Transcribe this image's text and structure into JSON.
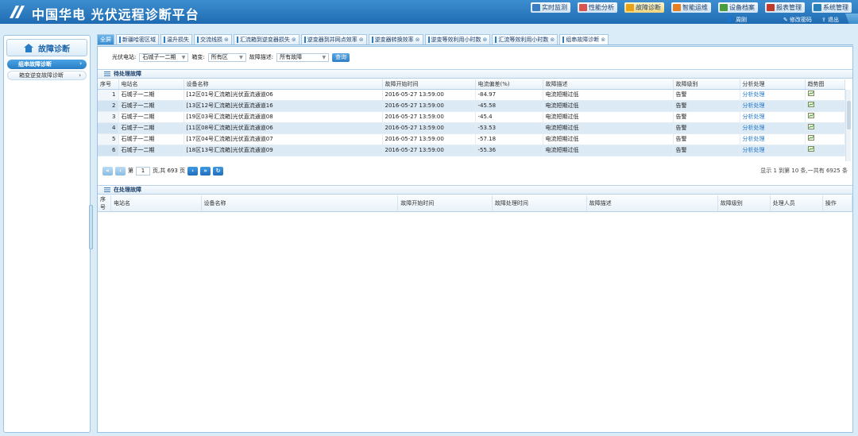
{
  "app": {
    "title": "中国华电 光伏远程诊断平台"
  },
  "topnav": [
    {
      "label": "实时监测",
      "color": "#3b7ec0"
    },
    {
      "label": "性能分析",
      "color": "#d9534f"
    },
    {
      "label": "故障诊断",
      "color": "#e8a21a"
    },
    {
      "label": "智能运维",
      "color": "#e67e22"
    },
    {
      "label": "设备档案",
      "color": "#4a9d3e"
    },
    {
      "label": "报表管理",
      "color": "#c0392b"
    },
    {
      "label": "系统管理",
      "color": "#2980b9"
    }
  ],
  "userbar": {
    "username": "周刚",
    "change_password": "修改密码",
    "logout": "退出"
  },
  "sidebar": {
    "title": "故障诊断",
    "items": [
      {
        "label": "组串故障诊断",
        "active": true
      },
      {
        "label": "箱变逆变故障诊断",
        "active": false
      }
    ]
  },
  "tabs": [
    {
      "label": "全屏"
    },
    {
      "label": "新疆哈密区域"
    },
    {
      "label": "温升损失"
    },
    {
      "label": "交流线损"
    },
    {
      "label": "汇流箱到逆变器损失"
    },
    {
      "label": "逆变器到并网点效率"
    },
    {
      "label": "逆变器转换效率"
    },
    {
      "label": "逆变等效利用小时数"
    },
    {
      "label": "汇流等效利用小时数"
    },
    {
      "label": "组串故障诊断"
    }
  ],
  "filters": {
    "station_label": "光伏电站:",
    "station_value": "石城子一二期",
    "area_label": "箱变:",
    "area_value": "所有区",
    "desc_label": "故障描述:",
    "desc_value": "所有故障",
    "query_button": "查询"
  },
  "pending": {
    "title": "待处理故障",
    "columns": [
      "序号",
      "电站名",
      "设备名称",
      "故障开始时间",
      "电流偏差(%)",
      "故障描述",
      "故障级别",
      "分析处理",
      "趋势图"
    ],
    "rows": [
      {
        "no": "1",
        "station": "石城子一二期",
        "device": "[12区01号汇流箱]光伏直流通道06",
        "time": "2016-05-27 13:59:00",
        "dev": "-84.97",
        "desc": "电流短期过低",
        "level": "告警",
        "action": "分析处理"
      },
      {
        "no": "2",
        "station": "石城子一二期",
        "device": "[13区12号汇流箱]光伏直流通道16",
        "time": "2016-05-27 13:59:00",
        "dev": "-45.58",
        "desc": "电流短期过低",
        "level": "告警",
        "action": "分析处理"
      },
      {
        "no": "3",
        "station": "石城子一二期",
        "device": "[19区03号汇流箱]光伏直流通道08",
        "time": "2016-05-27 13:59:00",
        "dev": "-45.4",
        "desc": "电流短期过低",
        "level": "告警",
        "action": "分析处理"
      },
      {
        "no": "4",
        "station": "石城子一二期",
        "device": "[11区08号汇流箱]光伏直流通道06",
        "time": "2016-05-27 13:59:00",
        "dev": "-53.53",
        "desc": "电流短期过低",
        "level": "告警",
        "action": "分析处理"
      },
      {
        "no": "5",
        "station": "石城子一二期",
        "device": "[17区04号汇流箱]光伏直流通道07",
        "time": "2016-05-27 13:59:00",
        "dev": "-57.18",
        "desc": "电流短期过低",
        "level": "告警",
        "action": "分析处理"
      },
      {
        "no": "6",
        "station": "石城子一二期",
        "device": "[18区13号汇流箱]光伏直流通道09",
        "time": "2016-05-27 13:59:00",
        "dev": "-55.36",
        "desc": "电流短期过低",
        "level": "告警",
        "action": "分析处理"
      }
    ]
  },
  "pager": {
    "page_label": "第",
    "page_value": "1",
    "total_label": "页,共 693 页",
    "info": "显示 1 到第 10 条,一共有 6925 条"
  },
  "processing": {
    "title": "在处理故障",
    "columns": [
      "序号",
      "电站名",
      "设备名称",
      "故障开始时间",
      "故障处理时间",
      "故障描述",
      "故障级别",
      "处理人员",
      "操作"
    ]
  }
}
